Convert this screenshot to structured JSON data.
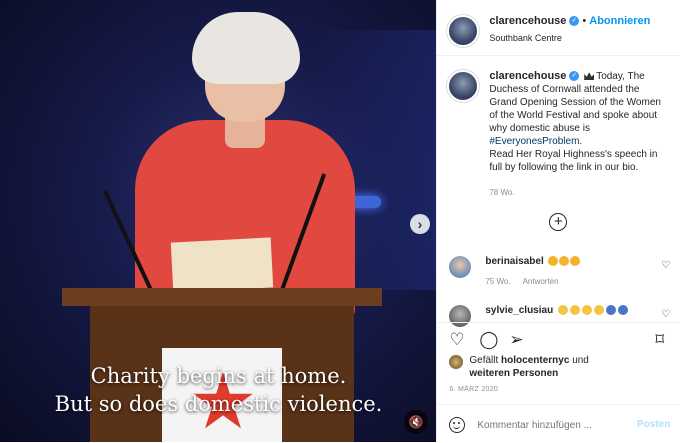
{
  "video": {
    "subtitle_line1": "Charity begins at home.",
    "subtitle_line2": "But so does domestic violence.",
    "next_icon": "chevron-right-icon",
    "mute_icon": "speaker-muted-icon"
  },
  "header": {
    "username": "clarencehouse",
    "follow_label": "Abonnieren",
    "location": "Southbank Centre"
  },
  "caption": {
    "username": "clarencehouse",
    "text_a": "Today, The Duchess of Cornwall attended the Grand Opening Session of the Women of the World Festival and spoke about why domestic abuse is ",
    "hashtag": "#EveryonesProblem",
    "text_b": ".",
    "text_c": "Read Her Royal Highness's speech in full by following the link in our bio.",
    "age": "78 Wo."
  },
  "comments": [
    {
      "username": "berinaisabel",
      "age": "75 Wo.",
      "reply_label": "Antworten"
    },
    {
      "username": "sylvie_clusiau"
    }
  ],
  "likes": {
    "prefix": "Gefällt",
    "user": "holocenternyc",
    "conj": "und",
    "others": "weiteren Personen"
  },
  "date": "6. MÄRZ 2020",
  "comment_input": {
    "placeholder": "Kommentar hinzufügen ..."
  },
  "post_label": "Posten",
  "colors": {
    "accent": "#0095f6",
    "dress": "#e1483f"
  }
}
